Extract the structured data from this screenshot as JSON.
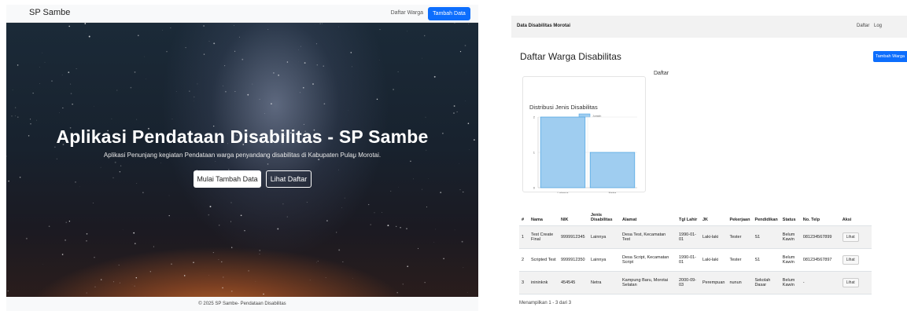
{
  "left": {
    "nav": {
      "brand": "SP Sambe",
      "link_daftar": "Daftar Warga",
      "btn_tambah": "Tambah Data"
    },
    "hero": {
      "title": "Aplikasi Pendataan Disabilitas - SP Sambe",
      "subtitle": "Aplikasi Penunjang kegiatan Pendataan warga penyandang disabilitas di Kabupaten Pulau Morotai.",
      "btn_primary": "Mulai Tambah Data",
      "btn_secondary": "Lihat Daftar"
    },
    "footer": "© 2025 SP Sambe- Pendataan Disabilitas"
  },
  "right": {
    "nav": {
      "brand": "Data Disabilitas Morotai",
      "link_daftar": "Daftar",
      "link_log": "Log"
    },
    "title": "Daftar Warga Disabilitas",
    "btn_tambah": "Tambah Warga",
    "daftar_label": "Daftar",
    "table": {
      "headers": [
        "#",
        "Nama",
        "NIK",
        "Jenis Disabilitas",
        "Alamat",
        "Tgl Lahir",
        "JK",
        "Pekerjaan",
        "Pendidikan",
        "Status",
        "No. Telp",
        "Aksi"
      ],
      "rows": [
        [
          "1",
          "Test Create Final",
          "9999912345",
          "Lainnya",
          "Desa Test, Kecamatan Test",
          "1990-01-01",
          "Laki-laki",
          "Tester",
          "S1",
          "Belum Kawin",
          "081234567899",
          "Lihat"
        ],
        [
          "2",
          "Scripted Test",
          "9999912350",
          "Lainnya",
          "Desa Script, Kecamatan Script",
          "1990-01-01",
          "Laki-laki",
          "Tester",
          "S1",
          "Belum Kawin",
          "081234567897",
          "Lihat"
        ],
        [
          "3",
          "inininknk",
          "454545",
          "Netra",
          "Kampung Baru, Morotai Selatan",
          "2000-09-03",
          "Perempuan",
          "nunun",
          "Sekolah Dasar",
          "Belum Kawin",
          "-",
          "Lihat"
        ]
      ]
    },
    "footer": "Menampilkan 1 - 3 dari 3"
  },
  "chart_data": {
    "type": "bar",
    "title": "Distribusi Jenis Disabilitas",
    "categories": [
      "Lainnya",
      "Netra"
    ],
    "series": [
      {
        "name": "Jumlah",
        "values": [
          2,
          1
        ]
      }
    ],
    "yticks": [
      "0",
      "1",
      "2"
    ],
    "ylim": [
      0,
      2
    ],
    "legend": "top",
    "colors": {
      "bar_fill": "#9fcdf0",
      "bar_stroke": "#3a9be0"
    }
  }
}
